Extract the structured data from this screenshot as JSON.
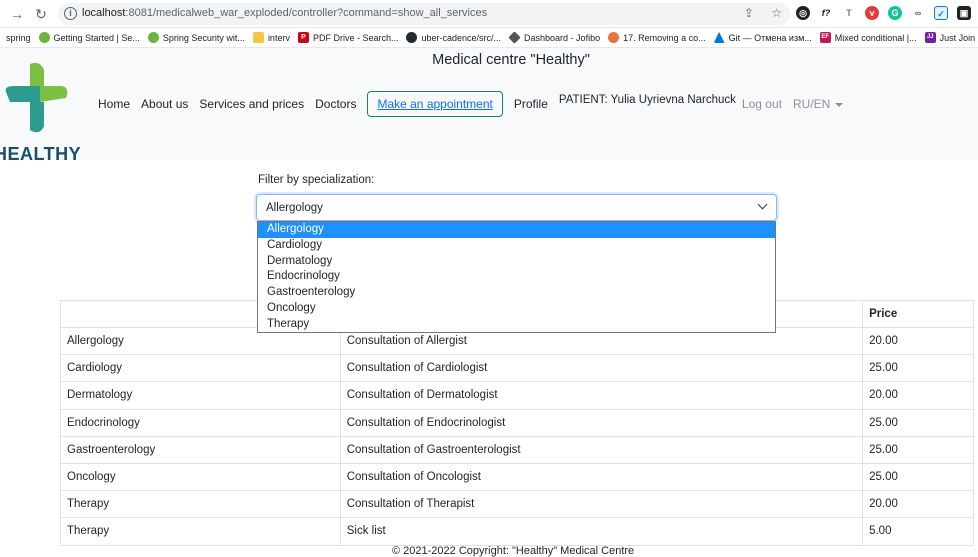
{
  "browser": {
    "back_icon": "→",
    "reload_icon": "↻",
    "url_host": "localhost",
    "url_path": ":8081/medicalweb_war_exploded/controller?command=show_all_services",
    "share_icon": "⇪",
    "star_icon": "☆"
  },
  "bookmarks": [
    {
      "label": "spring",
      "icon": "",
      "color": ""
    },
    {
      "label": "Getting Started | Se...",
      "icon": "ₑ",
      "color": "#6db33f"
    },
    {
      "label": "Spring Security wit...",
      "icon": "ₑ",
      "color": "#6db33f"
    },
    {
      "label": "interv",
      "icon": "",
      "color": "#f4c542"
    },
    {
      "label": "PDF Drive - Search...",
      "icon": "P",
      "color": "#d0021b"
    },
    {
      "label": "uber-cadence/src/...",
      "icon": "●",
      "color": "#24292e"
    },
    {
      "label": "Dashboard - Jofibo",
      "icon": "◆",
      "color": "#555"
    },
    {
      "label": "17. Removing a co...",
      "icon": "✋",
      "color": "#e8743b"
    },
    {
      "label": "Git — Отмена изм...",
      "icon": "▲",
      "color": "#0078d4"
    },
    {
      "label": "Mixed conditional |...",
      "icon": "EF",
      "color": "#c2185b"
    },
    {
      "label": "Just Join",
      "icon": "JJ",
      "color": "#7b1fa2"
    }
  ],
  "header": {
    "title": "Medical centre \"Healthy\"",
    "logo_text": "HEALTHY",
    "nav": {
      "home": "Home",
      "about": "About us",
      "services": "Services and prices",
      "doctors": "Doctors",
      "appointment": "Make an appointment",
      "profile": "Profile",
      "patient": "PATIENT: Yulia Uyrievna Narchuck",
      "logout": "Log out",
      "lang": "RU/EN"
    }
  },
  "filter": {
    "label": "Filter by specialization:",
    "selected": "Allergology",
    "options": [
      "Allergology",
      "Cardiology",
      "Dermatology",
      "Endocrinology",
      "Gastroenterology",
      "Oncology",
      "Therapy"
    ]
  },
  "table": {
    "headers": [
      "",
      "",
      "Price"
    ],
    "rows": [
      [
        "Allergology",
        "Consultation of Allergist",
        "20.00"
      ],
      [
        "Cardiology",
        "Consultation of Cardiologist",
        "25.00"
      ],
      [
        "Dermatology",
        "Consultation of Dermatologist",
        "20.00"
      ],
      [
        "Endocrinology",
        "Consultation of Endocrinologist",
        "25.00"
      ],
      [
        "Gastroenterology",
        "Consultation of Gastroenterologist",
        "25.00"
      ],
      [
        "Oncology",
        "Consultation of Oncologist",
        "25.00"
      ],
      [
        "Therapy",
        "Consultation of Therapist",
        "20.00"
      ],
      [
        "Therapy",
        "Sick list",
        "5.00"
      ]
    ]
  },
  "footer": {
    "text": "© 2021-2022 Copyright: \"Healthy\" Medical Centre"
  },
  "colors": {
    "accent": "#0d6efd",
    "selected_option": "#1e90ff",
    "header_bg": "#f8f9fa",
    "logo_teal": "#2a9d8f",
    "logo_green": "#7bc043"
  }
}
